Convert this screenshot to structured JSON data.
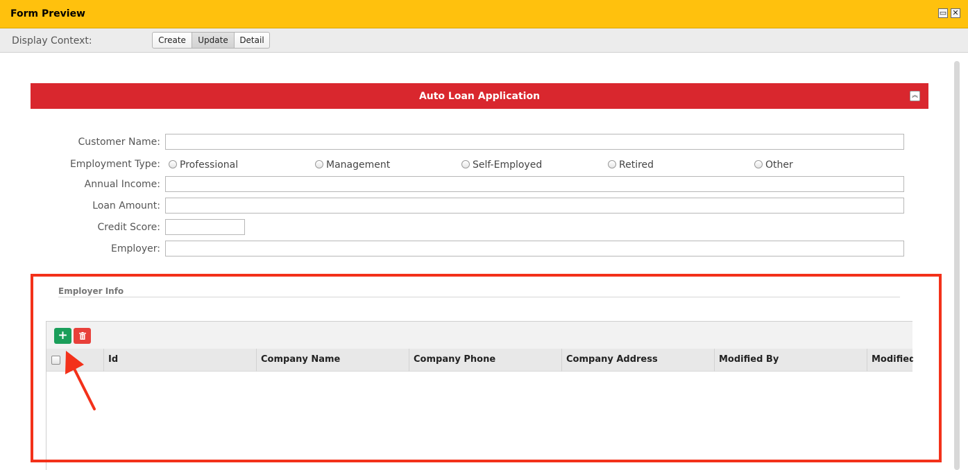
{
  "window": {
    "title": "Form Preview",
    "maximize_icon": "maximize-icon",
    "close_icon": "close-icon"
  },
  "context": {
    "label": "Display Context:",
    "options": [
      "Create",
      "Update",
      "Detail"
    ],
    "selected": "Update"
  },
  "form": {
    "title": "Auto Loan Application",
    "collapse_icon": "chevron-double-up-icon",
    "fields": {
      "customer_name": {
        "label": "Customer Name:",
        "value": ""
      },
      "employment_type": {
        "label": "Employment Type:",
        "options": [
          "Professional",
          "Management",
          "Self-Employed",
          "Retired",
          "Other"
        ]
      },
      "annual_income": {
        "label": "Annual Income:",
        "value": ""
      },
      "loan_amount": {
        "label": "Loan Amount:",
        "value": ""
      },
      "credit_score": {
        "label": "Credit Score:",
        "value": ""
      },
      "employer": {
        "label": "Employer:",
        "value": ""
      }
    }
  },
  "employer_info": {
    "title": "Employer Info",
    "add_icon": "plus-icon",
    "delete_icon": "trash-icon",
    "columns": [
      "Id",
      "Company Name",
      "Company Phone",
      "Company Address",
      "Modified By",
      "Modified"
    ],
    "rows": []
  },
  "annotation": {
    "highlight_color": "#f3311a",
    "arrow_color": "#f3311a"
  },
  "colors": {
    "titlebar": "#ffc10d",
    "banner": "#d9272e",
    "add_button": "#1a9e5a",
    "delete_button": "#e8403a"
  }
}
